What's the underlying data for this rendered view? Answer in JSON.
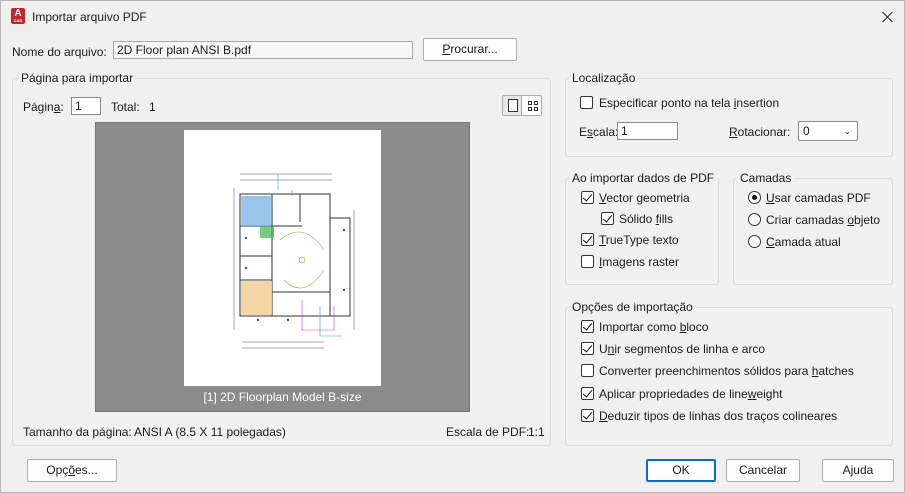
{
  "window": {
    "title": "Importar arquivo PDF"
  },
  "file": {
    "label_pre": "Nome do arquivo:",
    "value": "2D Floor plan ANSI B.pdf",
    "browse_pre": "",
    "browse_u": "P",
    "browse_post": "rocurar..."
  },
  "page_group": {
    "title": "Página para importar",
    "page_label_pre": "Págin",
    "page_label_u": "a",
    "page_label_post": ":",
    "page_value": "1",
    "total_label": "Total:",
    "total_value": "1",
    "preview_caption": "[1] 2D Floorplan Model B-size",
    "page_size_label": "Tamanho da página:",
    "page_size_value": "ANSI A (8.5 X 11 polegadas)",
    "pdf_scale_label": "Escala de PDF:",
    "pdf_scale_value": "1:1"
  },
  "location": {
    "title": "Localização",
    "specify_pre": "Especificar ponto na tela ",
    "specify_u": "i",
    "specify_post": "nsertion",
    "specify_checked": false,
    "scale_pre": "E",
    "scale_u": "s",
    "scale_post": "cala:",
    "scale_value": "1",
    "rotate_pre": "",
    "rotate_u": "R",
    "rotate_post": "otacionar:",
    "rotate_value": "0"
  },
  "pdf_data": {
    "title": "Ao importar dados de PDF",
    "items": [
      {
        "pre": "",
        "u": "V",
        "post": "ector geometria",
        "checked": true
      },
      {
        "pre": "Sólido ",
        "u": "f",
        "post": "ills",
        "checked": true
      },
      {
        "pre": "",
        "u": "T",
        "post": "rueType texto",
        "checked": true
      },
      {
        "pre": "",
        "u": "I",
        "post": "magens raster",
        "checked": false
      }
    ]
  },
  "layers": {
    "title": "Camadas",
    "items": [
      {
        "pre": "",
        "u": "U",
        "post": "sar camadas PDF",
        "checked": true
      },
      {
        "pre": "Criar camadas ",
        "u": "o",
        "post": "bjeto",
        "checked": false
      },
      {
        "pre": "",
        "u": "C",
        "post": "amada atual",
        "checked": false
      }
    ]
  },
  "import_options": {
    "title": "Opções de importação",
    "items": [
      {
        "pre": "Importar como ",
        "u": "b",
        "post": "loco",
        "checked": true
      },
      {
        "pre": "U",
        "u": "n",
        "post": "ir segmentos de linha e arco",
        "checked": true
      },
      {
        "pre": "Converter preenchimentos sólidos para ",
        "u": "h",
        "post": "atches",
        "checked": false
      },
      {
        "pre": "Aplicar propriedades de line",
        "u": "w",
        "post": "eight",
        "checked": true
      },
      {
        "pre": "",
        "u": "D",
        "post": "eduzir tipos de linhas dos traços colineares",
        "checked": true
      }
    ]
  },
  "footer": {
    "options_pre": "Opç",
    "options_u": "õ",
    "options_post": "es...",
    "ok": "OK",
    "cancel": "Cancelar",
    "help": "Ajuda"
  },
  "colors": {
    "accent": "#0f68c6",
    "preview_bg": "#8b8b8b",
    "logo": "#c1272d"
  }
}
